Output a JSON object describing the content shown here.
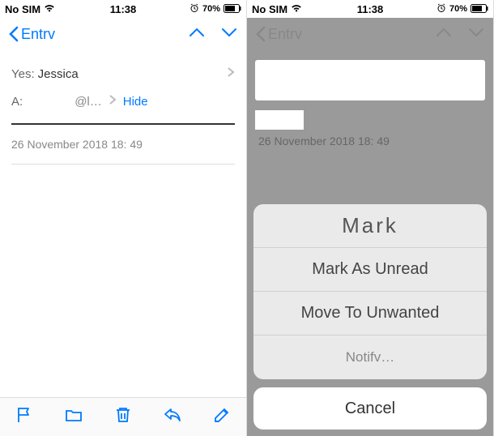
{
  "status": {
    "carrier": "No SIM",
    "time": "11:38",
    "battery": "70%"
  },
  "nav": {
    "back_label": "Entrv"
  },
  "left": {
    "from_label": "Yes:",
    "from_value": "Jessica",
    "to_label": "A:",
    "to_value": "@l…",
    "hide_label": "Hide",
    "timestamp": "26 November 2018 18: 49"
  },
  "right": {
    "timestamp": "26 November 2018 18: 49"
  },
  "sheet": {
    "title": "Mark",
    "items": [
      "Mark As Unread",
      "Move To Unwanted",
      "Notifv…"
    ],
    "cancel": "Cancel"
  }
}
